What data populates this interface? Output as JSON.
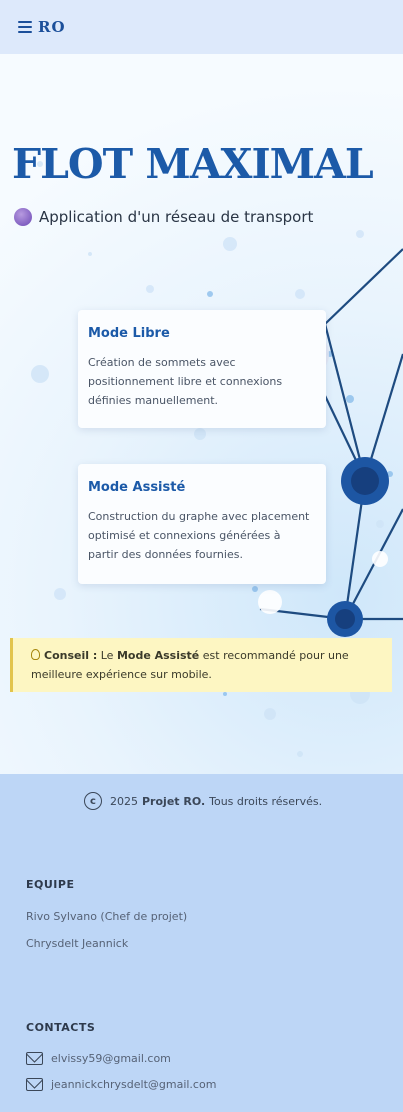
{
  "header": {
    "logo": "RO"
  },
  "hero": {
    "title": "FLOT MAXIMAL",
    "subtitle": "Application d'un réseau de transport"
  },
  "cards": [
    {
      "title": "Mode Libre",
      "text": "Création de sommets avec positionnement libre et connexions définies manuellement."
    },
    {
      "title": "Mode Assisté",
      "text": "Construction du graphe avec placement optimisé et connexions générées à partir des données fournies."
    }
  ],
  "tip": {
    "label": "Conseil :",
    "before": "Le",
    "mode": "Mode Assisté",
    "after": "est recommandé pour une meilleure expérience sur mobile."
  },
  "footer": {
    "year": "2025",
    "project": "Projet RO.",
    "rights": "Tous droits réservés.",
    "team_title": "EQUIPE",
    "team": [
      "Rivo Sylvano (Chef de projet)",
      "Chrysdelt Jeannick"
    ],
    "contacts_title": "CONTACTS",
    "contacts": [
      "elvissy59@gmail.com",
      "jeannickchrysdelt@gmail.com"
    ]
  },
  "icons": [
    "menu-icon",
    "bubble-icon",
    "lightbulb-icon",
    "copyright-icon",
    "mail-icon"
  ],
  "colors": {
    "accent": "#1c5aa8",
    "footer_bg": "#bdd6f6",
    "tip_bg": "#fdf6c2"
  }
}
